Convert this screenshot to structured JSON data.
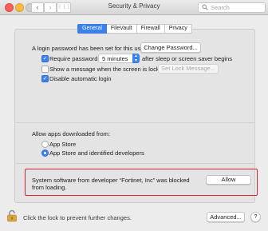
{
  "window": {
    "title": "Security & Privacy",
    "search_placeholder": "Search"
  },
  "toolbar": {
    "back_icon": "chevron-left-icon",
    "back_glyph": "‹",
    "forward_icon": "chevron-right-icon",
    "forward_glyph": "›",
    "grid_icon": "grid-icon",
    "grid_glyph": "⋮⋮⋮"
  },
  "tabs": [
    {
      "label": "General",
      "active": true
    },
    {
      "label": "FileVault",
      "active": false
    },
    {
      "label": "Firewall",
      "active": false
    },
    {
      "label": "Privacy",
      "active": false
    }
  ],
  "general": {
    "login_password_text": "A login password has been set for this user",
    "change_password_label": "Change Password...",
    "require_password": {
      "label": "Require password",
      "checked": true,
      "delay_value": "5 minutes",
      "suffix": "after sleep or screen saver begins"
    },
    "show_message": {
      "label": "Show a message when the screen is locked",
      "checked": false,
      "button_label": "Set Lock Message..."
    },
    "disable_auto_login": {
      "label": "Disable automatic login",
      "checked": true
    },
    "allow_apps": {
      "heading": "Allow apps downloaded from:",
      "options": [
        {
          "label": "App Store",
          "selected": false
        },
        {
          "label": "App Store and identified developers",
          "selected": true
        }
      ]
    },
    "blocked_notice": {
      "line1": "System software from developer “Fortinet, Inc” was blocked",
      "line2": "from loading.",
      "allow_label": "Allow"
    }
  },
  "footer": {
    "lock_text": "Click the lock to prevent further changes.",
    "advanced_label": "Advanced...",
    "help_glyph": "?"
  },
  "colors": {
    "accent": "#3b80ee",
    "highlight_border": "#d9262c",
    "window_bg": "#ececec"
  }
}
